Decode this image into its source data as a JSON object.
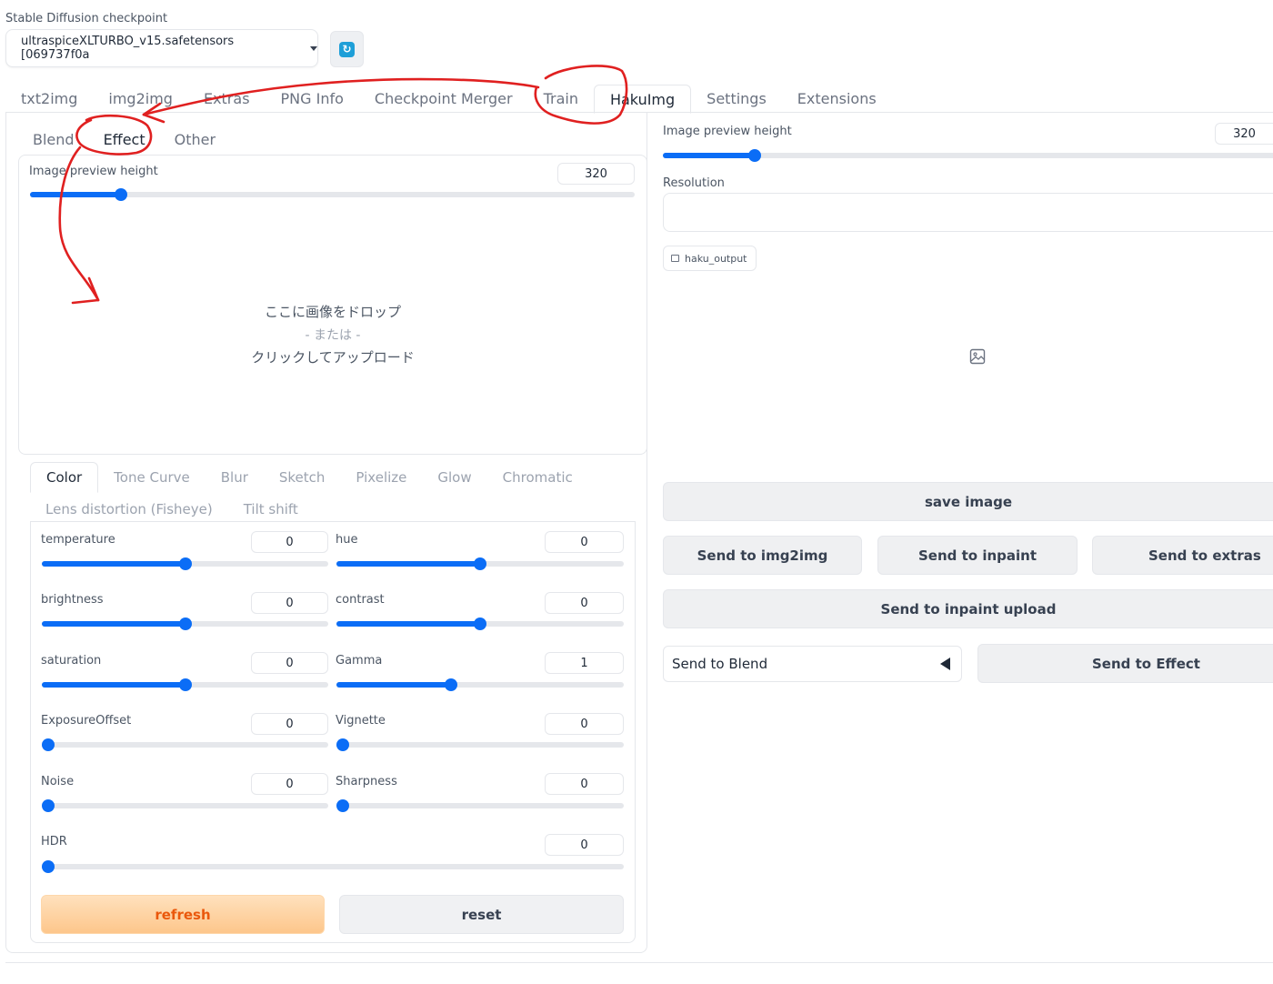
{
  "checkpoint": {
    "label": "Stable Diffusion checkpoint",
    "value": "ultraspiceXLTURBO_v15.safetensors [069737f0a",
    "refresh_icon": "refresh-icon"
  },
  "main_tabs": [
    {
      "label": "txt2img",
      "active": false
    },
    {
      "label": "img2img",
      "active": false
    },
    {
      "label": "Extras",
      "active": false
    },
    {
      "label": "PNG Info",
      "active": false
    },
    {
      "label": "Checkpoint Merger",
      "active": false
    },
    {
      "label": "Train",
      "active": false
    },
    {
      "label": "HakuImg",
      "active": true
    },
    {
      "label": "Settings",
      "active": false
    },
    {
      "label": "Extensions",
      "active": false
    }
  ],
  "left": {
    "subtabs": [
      {
        "label": "Blend",
        "active": false
      },
      {
        "label": "Effect",
        "active": true
      },
      {
        "label": "Other",
        "active": false
      }
    ],
    "preview_height": {
      "label": "Image preview height",
      "value": "320",
      "fraction": 0.15
    },
    "dropzone": {
      "line1": "ここに画像をドロップ",
      "line2": "- または -",
      "line3": "クリックしてアップロード"
    },
    "effect_tabs_row1": [
      {
        "label": "Color",
        "active": true
      },
      {
        "label": "Tone Curve",
        "active": false
      },
      {
        "label": "Blur",
        "active": false
      },
      {
        "label": "Sketch",
        "active": false
      },
      {
        "label": "Pixelize",
        "active": false
      },
      {
        "label": "Glow",
        "active": false
      },
      {
        "label": "Chromatic",
        "active": false
      }
    ],
    "effect_tabs_row2": [
      {
        "label": "Lens distortion (Fisheye)",
        "active": false
      },
      {
        "label": "Tilt shift",
        "active": false
      }
    ],
    "controls": {
      "temperature": {
        "label": "temperature",
        "value": "0",
        "fraction": 0.5
      },
      "hue": {
        "label": "hue",
        "value": "0",
        "fraction": 0.5
      },
      "brightness": {
        "label": "brightness",
        "value": "0",
        "fraction": 0.5
      },
      "contrast": {
        "label": "contrast",
        "value": "0",
        "fraction": 0.5
      },
      "saturation": {
        "label": "saturation",
        "value": "0",
        "fraction": 0.5
      },
      "gamma": {
        "label": "Gamma",
        "value": "1",
        "fraction": 0.4
      },
      "exposure": {
        "label": "ExposureOffset",
        "value": "0",
        "fraction": 0.0
      },
      "vignette": {
        "label": "Vignette",
        "value": "0",
        "fraction": 0.0
      },
      "noise": {
        "label": "Noise",
        "value": "0",
        "fraction": 0.0
      },
      "sharpness": {
        "label": "Sharpness",
        "value": "0",
        "fraction": 0.0
      },
      "hdr": {
        "label": "HDR",
        "value": "0",
        "fraction": 0.0
      }
    },
    "refresh_label": "refresh",
    "reset_label": "reset"
  },
  "right": {
    "preview_height": {
      "label": "Image preview height",
      "value": "320",
      "fraction": 0.15
    },
    "resolution_label": "Resolution",
    "resolution_value": "",
    "output_tag": "haku_output",
    "image_icon": "image-icon",
    "save_label": "save image",
    "send_img2img": "Send to img2img",
    "send_inpaint": "Send to inpaint",
    "send_extras": "Send to extras",
    "send_inpaint_upload": "Send to inpaint upload",
    "send_select_value": "Send to Blend",
    "send_effect": "Send to Effect"
  },
  "colors": {
    "accent": "#0b6df6",
    "annotation": "#e02020",
    "refresh_text": "#ea580c"
  }
}
